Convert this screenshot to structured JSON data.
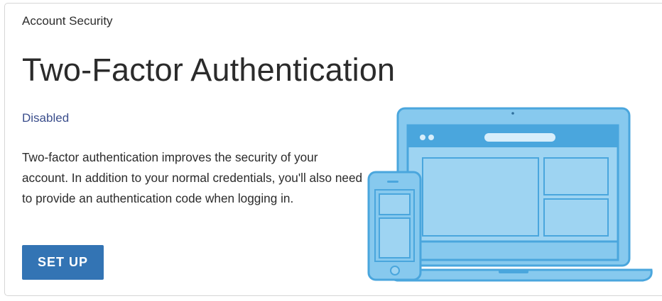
{
  "breadcrumb": "Account Security",
  "title": "Two-Factor Authentication",
  "status": "Disabled",
  "description": "Two-factor authentication improves the security of your account. In addition to your normal credentials, you'll also need to provide an authentication code when logging in.",
  "setup_button_label": "SET UP",
  "colors": {
    "accent": "#3374b4",
    "status": "#3b4e8c",
    "illustration_fill": "#87c9ee",
    "illustration_stroke": "#4aa6dd"
  },
  "illustration": {
    "icon": "laptop-and-phone-icon"
  }
}
